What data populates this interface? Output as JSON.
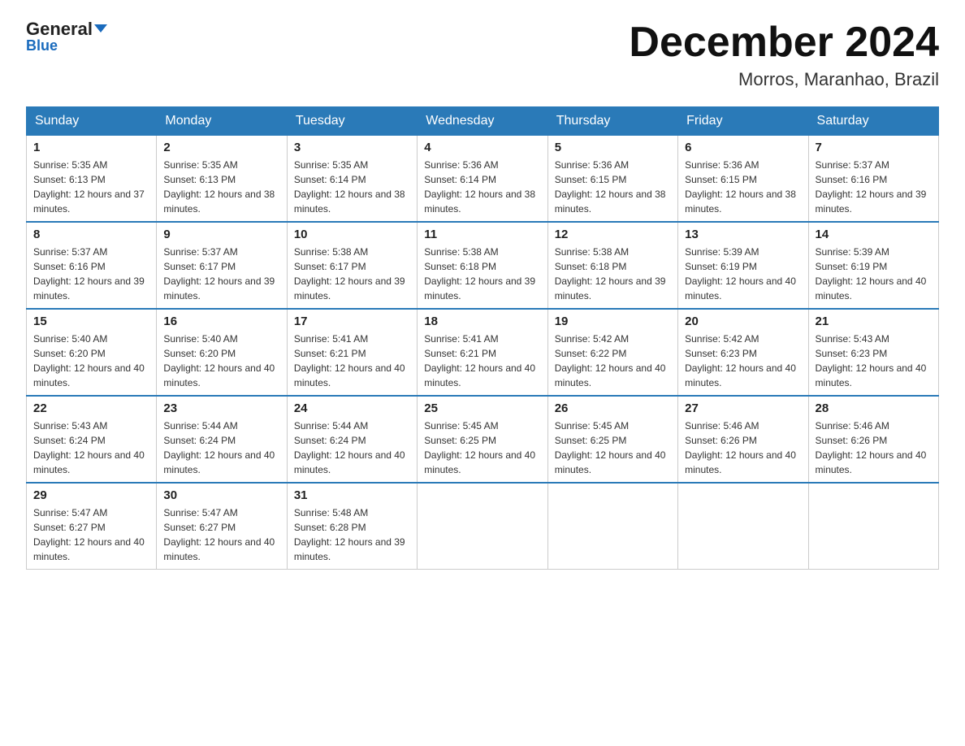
{
  "header": {
    "logo_line1": "General",
    "logo_line2": "Blue",
    "calendar_title": "December 2024",
    "calendar_subtitle": "Morros, Maranhao, Brazil"
  },
  "days_of_week": [
    "Sunday",
    "Monday",
    "Tuesday",
    "Wednesday",
    "Thursday",
    "Friday",
    "Saturday"
  ],
  "weeks": [
    [
      {
        "day": "1",
        "sunrise": "5:35 AM",
        "sunset": "6:13 PM",
        "daylight": "12 hours and 37 minutes."
      },
      {
        "day": "2",
        "sunrise": "5:35 AM",
        "sunset": "6:13 PM",
        "daylight": "12 hours and 38 minutes."
      },
      {
        "day": "3",
        "sunrise": "5:35 AM",
        "sunset": "6:14 PM",
        "daylight": "12 hours and 38 minutes."
      },
      {
        "day": "4",
        "sunrise": "5:36 AM",
        "sunset": "6:14 PM",
        "daylight": "12 hours and 38 minutes."
      },
      {
        "day": "5",
        "sunrise": "5:36 AM",
        "sunset": "6:15 PM",
        "daylight": "12 hours and 38 minutes."
      },
      {
        "day": "6",
        "sunrise": "5:36 AM",
        "sunset": "6:15 PM",
        "daylight": "12 hours and 38 minutes."
      },
      {
        "day": "7",
        "sunrise": "5:37 AM",
        "sunset": "6:16 PM",
        "daylight": "12 hours and 39 minutes."
      }
    ],
    [
      {
        "day": "8",
        "sunrise": "5:37 AM",
        "sunset": "6:16 PM",
        "daylight": "12 hours and 39 minutes."
      },
      {
        "day": "9",
        "sunrise": "5:37 AM",
        "sunset": "6:17 PM",
        "daylight": "12 hours and 39 minutes."
      },
      {
        "day": "10",
        "sunrise": "5:38 AM",
        "sunset": "6:17 PM",
        "daylight": "12 hours and 39 minutes."
      },
      {
        "day": "11",
        "sunrise": "5:38 AM",
        "sunset": "6:18 PM",
        "daylight": "12 hours and 39 minutes."
      },
      {
        "day": "12",
        "sunrise": "5:38 AM",
        "sunset": "6:18 PM",
        "daylight": "12 hours and 39 minutes."
      },
      {
        "day": "13",
        "sunrise": "5:39 AM",
        "sunset": "6:19 PM",
        "daylight": "12 hours and 40 minutes."
      },
      {
        "day": "14",
        "sunrise": "5:39 AM",
        "sunset": "6:19 PM",
        "daylight": "12 hours and 40 minutes."
      }
    ],
    [
      {
        "day": "15",
        "sunrise": "5:40 AM",
        "sunset": "6:20 PM",
        "daylight": "12 hours and 40 minutes."
      },
      {
        "day": "16",
        "sunrise": "5:40 AM",
        "sunset": "6:20 PM",
        "daylight": "12 hours and 40 minutes."
      },
      {
        "day": "17",
        "sunrise": "5:41 AM",
        "sunset": "6:21 PM",
        "daylight": "12 hours and 40 minutes."
      },
      {
        "day": "18",
        "sunrise": "5:41 AM",
        "sunset": "6:21 PM",
        "daylight": "12 hours and 40 minutes."
      },
      {
        "day": "19",
        "sunrise": "5:42 AM",
        "sunset": "6:22 PM",
        "daylight": "12 hours and 40 minutes."
      },
      {
        "day": "20",
        "sunrise": "5:42 AM",
        "sunset": "6:23 PM",
        "daylight": "12 hours and 40 minutes."
      },
      {
        "day": "21",
        "sunrise": "5:43 AM",
        "sunset": "6:23 PM",
        "daylight": "12 hours and 40 minutes."
      }
    ],
    [
      {
        "day": "22",
        "sunrise": "5:43 AM",
        "sunset": "6:24 PM",
        "daylight": "12 hours and 40 minutes."
      },
      {
        "day": "23",
        "sunrise": "5:44 AM",
        "sunset": "6:24 PM",
        "daylight": "12 hours and 40 minutes."
      },
      {
        "day": "24",
        "sunrise": "5:44 AM",
        "sunset": "6:24 PM",
        "daylight": "12 hours and 40 minutes."
      },
      {
        "day": "25",
        "sunrise": "5:45 AM",
        "sunset": "6:25 PM",
        "daylight": "12 hours and 40 minutes."
      },
      {
        "day": "26",
        "sunrise": "5:45 AM",
        "sunset": "6:25 PM",
        "daylight": "12 hours and 40 minutes."
      },
      {
        "day": "27",
        "sunrise": "5:46 AM",
        "sunset": "6:26 PM",
        "daylight": "12 hours and 40 minutes."
      },
      {
        "day": "28",
        "sunrise": "5:46 AM",
        "sunset": "6:26 PM",
        "daylight": "12 hours and 40 minutes."
      }
    ],
    [
      {
        "day": "29",
        "sunrise": "5:47 AM",
        "sunset": "6:27 PM",
        "daylight": "12 hours and 40 minutes."
      },
      {
        "day": "30",
        "sunrise": "5:47 AM",
        "sunset": "6:27 PM",
        "daylight": "12 hours and 40 minutes."
      },
      {
        "day": "31",
        "sunrise": "5:48 AM",
        "sunset": "6:28 PM",
        "daylight": "12 hours and 39 minutes."
      },
      null,
      null,
      null,
      null
    ]
  ]
}
